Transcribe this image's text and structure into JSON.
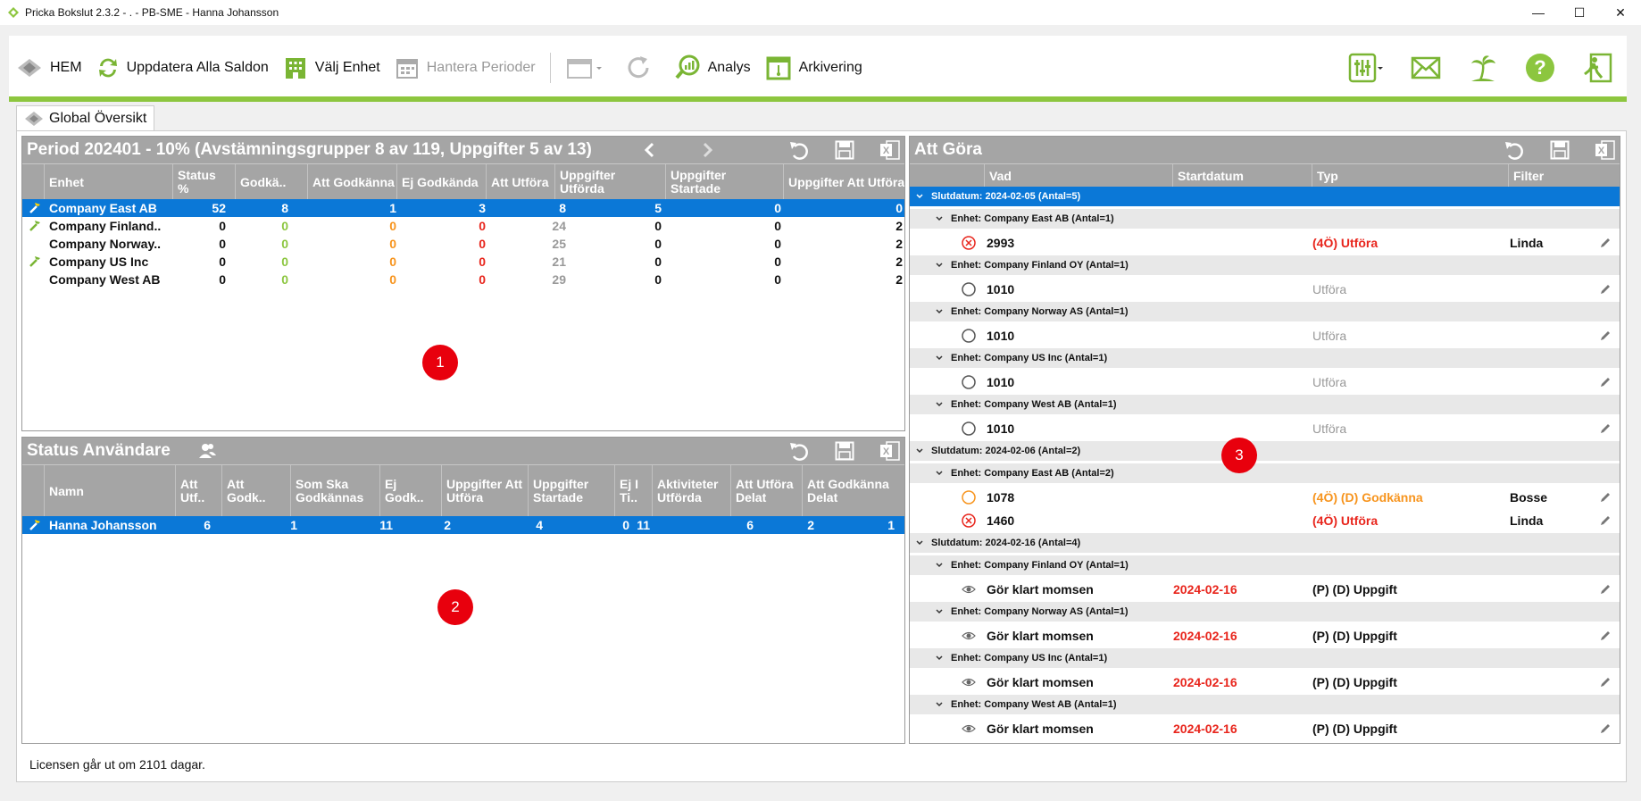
{
  "window": {
    "title": "Pricka Bokslut 2.3.2  - . - PB-SME - Hanna Johansson",
    "minimize": "—",
    "maximize": "☐",
    "close": "✕"
  },
  "toolbar": {
    "home": "HEM",
    "update": "Uppdatera Alla Saldon",
    "select_unit": "Välj Enhet",
    "periods": "Hantera Perioder",
    "analysis": "Analys",
    "archive": "Arkivering"
  },
  "tab": {
    "label": "Global Översikt"
  },
  "period_panel": {
    "title": "Period 202401 - 10% (Avstämningsgrupper 8 av 119, Uppgifter 5 av 13)",
    "columns": [
      "Enhet",
      "Status %",
      "Godkä..",
      "Att Godkänna",
      "Ej Godkända",
      "Att Utföra",
      "Uppgifter Utförda",
      "Uppgifter Startade",
      "Uppgifter Att Utföra"
    ],
    "rows": [
      {
        "name": "Company East AB",
        "status": "52",
        "godk": "8",
        "att_godk": "1",
        "ej_godk": "3",
        "att_utf": "8",
        "upp_utf": "5",
        "upp_start": "0",
        "upp_att": "0"
      },
      {
        "name": "Company Finland..",
        "status": "0",
        "godk": "0",
        "att_godk": "0",
        "ej_godk": "0",
        "att_utf": "24",
        "upp_utf": "0",
        "upp_start": "0",
        "upp_att": "2"
      },
      {
        "name": "Company Norway..",
        "status": "0",
        "godk": "0",
        "att_godk": "0",
        "ej_godk": "0",
        "att_utf": "25",
        "upp_utf": "0",
        "upp_start": "0",
        "upp_att": "2"
      },
      {
        "name": "Company US Inc",
        "status": "0",
        "godk": "0",
        "att_godk": "0",
        "ej_godk": "0",
        "att_utf": "21",
        "upp_utf": "0",
        "upp_start": "0",
        "upp_att": "2"
      },
      {
        "name": "Company West AB",
        "status": "0",
        "godk": "0",
        "att_godk": "0",
        "ej_godk": "0",
        "att_utf": "29",
        "upp_utf": "0",
        "upp_start": "0",
        "upp_att": "2"
      }
    ],
    "badge": "1"
  },
  "users_panel": {
    "title": "Status Användare",
    "columns": [
      "Namn",
      "Att Utf..",
      "Att Godk..",
      "Som Ska Godkännas",
      "Ej Godk..",
      "Uppgifter Att Utföra",
      "Uppgifter Startade",
      "Ej I Ti..",
      "Aktiviteter Utförda",
      "Att Utföra Delat",
      "Att Godkänna Delat"
    ],
    "rows": [
      {
        "name": "Hanna Johansson",
        "v1": "6",
        "v2": "1",
        "v3": "11",
        "v4": "2",
        "v5": "4",
        "v6": "0",
        "v7": "11",
        "v8": "6",
        "v9": "2",
        "v10": "1"
      }
    ],
    "badge": "2"
  },
  "todo_panel": {
    "title": "Att Göra",
    "columns": [
      "Vad",
      "Startdatum",
      "Typ",
      "Filter"
    ],
    "groups": [
      {
        "label": "Slutdatum: 2024-02-05 (Antal=5)"
      },
      {
        "label": "Slutdatum: 2024-02-06 (Antal=2)"
      },
      {
        "label": "Slutdatum: 2024-02-16 (Antal=4)"
      }
    ],
    "subgroups": [
      "Enhet: Company East AB (Antal=1)",
      "Enhet: Company Finland OY (Antal=1)",
      "Enhet: Company Norway AS (Antal=1)",
      "Enhet: Company US Inc (Antal=1)",
      "Enhet: Company West AB (Antal=1)",
      "Enhet: Company East AB (Antal=2)",
      "Enhet: Company Finland OY (Antal=1)",
      "Enhet: Company Norway AS (Antal=1)",
      "Enhet: Company US Inc (Antal=1)",
      "Enhet: Company West AB (Antal=1)"
    ],
    "items": [
      {
        "vad": "2993",
        "start": "",
        "typ": "(4Ö) Utföra",
        "filter": "Linda"
      },
      {
        "vad": "1010",
        "start": "",
        "typ": "Utföra",
        "filter": ""
      },
      {
        "vad": "1010",
        "start": "",
        "typ": "Utföra",
        "filter": ""
      },
      {
        "vad": "1010",
        "start": "",
        "typ": "Utföra",
        "filter": ""
      },
      {
        "vad": "1010",
        "start": "",
        "typ": "Utföra",
        "filter": ""
      },
      {
        "vad": "1078",
        "start": "",
        "typ": "(4Ö) (D) Godkänna",
        "filter": "Bosse"
      },
      {
        "vad": "1460",
        "start": "",
        "typ": "(4Ö) Utföra",
        "filter": "Linda"
      },
      {
        "vad": "Gör klart momsen",
        "start": "2024-02-16",
        "typ": "(P) (D) Uppgift",
        "filter": ""
      },
      {
        "vad": "Gör klart momsen",
        "start": "2024-02-16",
        "typ": "(P) (D) Uppgift",
        "filter": ""
      },
      {
        "vad": "Gör klart momsen",
        "start": "2024-02-16",
        "typ": "(P) (D) Uppgift",
        "filter": ""
      },
      {
        "vad": "Gör klart momsen",
        "start": "2024-02-16",
        "typ": "(P) (D) Uppgift",
        "filter": ""
      }
    ],
    "badge": "3"
  },
  "footer": {
    "license": "Licensen går ut om 2101 dagar."
  },
  "colors": {
    "accent": "#8dc63f",
    "selection": "#0b78d7",
    "header": "#a5a5a5",
    "badge": "#e8000d"
  }
}
